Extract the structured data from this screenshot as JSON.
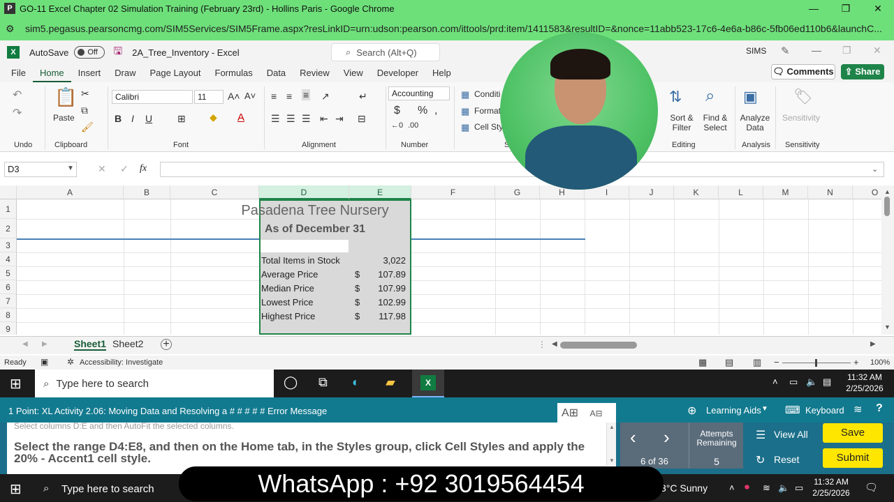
{
  "browser": {
    "title": "GO-11 Excel Chapter 02 Simulation Training (February 23rd) - Hollins Paris - Google Chrome",
    "url": "sim5.pegasus.pearsoncmg.com/SIM5Services/SIM5Frame.aspx?resLinkID=urn:udson:pearson.com/ittools/prd:item/1411583&resultID=&nonce=11abb523-17c6-4e6a-b86c-5fb06ed110b6&launchC..."
  },
  "excel": {
    "autosave_label": "AutoSave",
    "autosave_state": "Off",
    "filename": "2A_Tree_Inventory - Excel",
    "search_placeholder": "Search (Alt+Q)",
    "sims_label": "SIMS",
    "menu": [
      "File",
      "Home",
      "Insert",
      "Draw",
      "Page Layout",
      "Formulas",
      "Data",
      "Review",
      "View",
      "Developer",
      "Help"
    ],
    "comments_label": "Comments",
    "share_label": "Share"
  },
  "ribbon": {
    "undo_group": "Undo",
    "clipboard_group": "Clipboard",
    "paste_label": "Paste",
    "font_group": "Font",
    "font_name": "Calibri",
    "font_size": "11",
    "alignment_group": "Alignment",
    "number_group": "Number",
    "number_format": "Accounting",
    "styles_group": "S",
    "conditional_label": "Conditi",
    "format_label": "Format",
    "cellstyles_label": "Cell Sty",
    "editing_group": "Editing",
    "sortfilter_label": "Sort & Filter",
    "findselect_label": "Find & Select",
    "analysis_group": "Analysis",
    "analyze_label": "Analyze Data",
    "sensitivity_group": "Sensitivity",
    "sensitivity_label": "Sensitivity"
  },
  "formula_bar": {
    "name_box": "D3",
    "fx": "fx",
    "content": ""
  },
  "grid": {
    "columns": [
      "A",
      "B",
      "C",
      "D",
      "E",
      "F",
      "G",
      "H",
      "I",
      "J",
      "K",
      "L",
      "M",
      "N",
      "O"
    ],
    "rows": [
      "1",
      "2",
      "3",
      "4",
      "5",
      "6",
      "7",
      "8",
      "9"
    ],
    "title": "Pasadena Tree Nursery",
    "subtitle": "As of December 31",
    "labels": [
      "Total Items in Stock",
      "Average Price",
      "Median Price",
      "Lowest Price",
      "Highest Price"
    ],
    "currency": [
      "",
      "$",
      "$",
      "$",
      "$"
    ],
    "values": [
      "3,022",
      "107.89",
      "107.99",
      "102.99",
      "117.98"
    ]
  },
  "sheets": {
    "tabs": [
      "Sheet1",
      "Sheet2"
    ],
    "active": "Sheet1",
    "add": "+"
  },
  "status": {
    "ready": "Ready",
    "accessibility": "Accessibility: Investigate",
    "zoom": "100%"
  },
  "taskbar": {
    "search_placeholder": "Type here to search",
    "time": "11:32 AM",
    "date": "2/25/2026",
    "weather": "3°C  Sunny"
  },
  "sim": {
    "task_title": "1 Point: XL Activity 2.06: Moving Data and Resolving a # # # # # Error Message",
    "learning_aids": "Learning Aids",
    "keyboard": "Keyboard",
    "previous_instruction": "Select columns D:E and then AutoFit the selected columns.",
    "instruction": "Select the range D4:E8, and then on the Home tab, in the Styles group, click Cell Styles and apply the 20% - Accent1 cell style.",
    "progress": "6 of 36",
    "attempts_label": "Attempts Remaining",
    "attempts": "5",
    "view_all": "View All",
    "reset": "Reset",
    "save": "Save",
    "submit": "Submit"
  },
  "overlay": {
    "whatsapp": "WhatsApp : +92 3019564454"
  },
  "colors": {
    "chrome_green": "#6ee07a",
    "excel_green": "#1e8449",
    "sim_teal": "#127a8f",
    "button_yellow": "#ffe600"
  }
}
